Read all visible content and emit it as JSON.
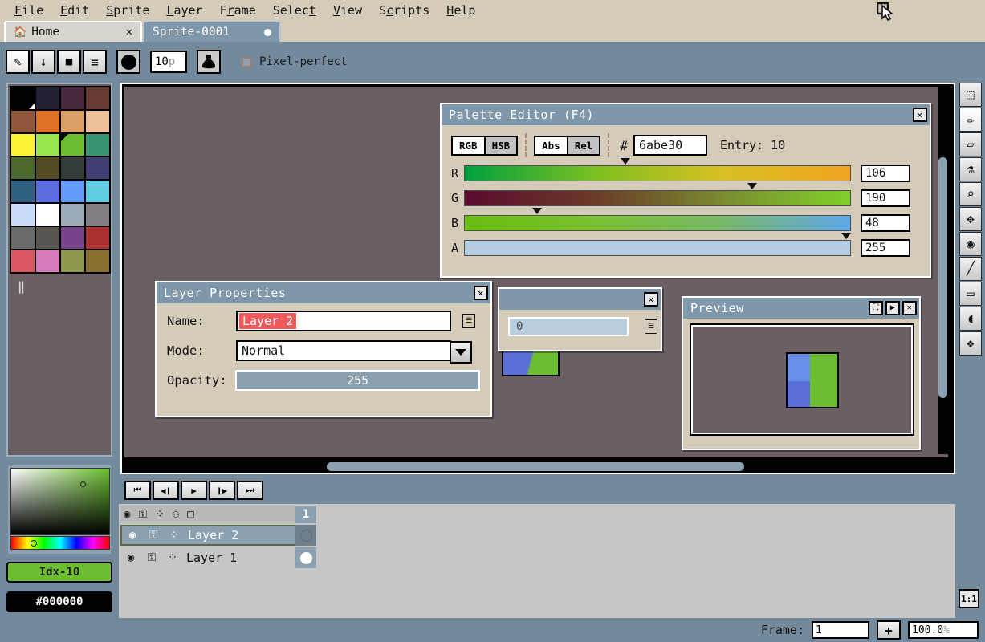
{
  "menu": {
    "items": [
      "File",
      "Edit",
      "Sprite",
      "Layer",
      "Frame",
      "Select",
      "View",
      "Scripts",
      "Help"
    ]
  },
  "tabs": [
    {
      "label": "Home",
      "icon": "home-icon",
      "close": "✕",
      "active": false
    },
    {
      "label": "Sprite-0001",
      "icon": "dot-indicator",
      "active": true
    }
  ],
  "toolbar": {
    "buttons": [
      {
        "name": "pencil-tool-button",
        "glyph": "✎"
      },
      {
        "name": "down-arrow-button",
        "glyph": "↓"
      },
      {
        "name": "square-button",
        "glyph": "■"
      },
      {
        "name": "menu-button",
        "glyph": "≡"
      }
    ],
    "brush_shape": "circle",
    "brush_size": "10",
    "brush_size_unit": "p",
    "ink_button": "ink-bucket-icon",
    "pixel_perfect_label": "Pixel-perfect",
    "pixel_perfect_checked": false
  },
  "palette": {
    "selected_index": 10,
    "colors": [
      "#000000",
      "#222034",
      "#45283c",
      "#663931",
      "#8f563b",
      "#df7126",
      "#d9a066",
      "#eec39a",
      "#fbf236",
      "#99e550",
      "#6abe30",
      "#37946e",
      "#4b692f",
      "#524b24",
      "#323c39",
      "#3f3f74",
      "#306082",
      "#5b6ee1",
      "#639bff",
      "#5fcde4",
      "#cbdbfc",
      "#ffffff",
      "#9badb7",
      "#847e87",
      "#696a6a",
      "#595652",
      "#76428a",
      "#ac3232",
      "#d95763",
      "#d77bba",
      "#8f974a",
      "#8a6f30"
    ],
    "pause_glyph": "‖"
  },
  "color_picker": {
    "fg_label": "Idx-10",
    "fg_color": "#6abe30",
    "bg_label": "#000000",
    "bg_color": "#000000"
  },
  "canvas": {
    "hscroll": "horizontal-scrollbar",
    "vscroll": "vertical-scrollbar"
  },
  "right_tools": [
    {
      "name": "marquee-select-tool",
      "glyph": "⬚"
    },
    {
      "name": "pencil-tool",
      "glyph": "✏"
    },
    {
      "name": "eraser-tool",
      "glyph": "▱"
    },
    {
      "name": "eyedropper-tool",
      "glyph": "⚗"
    },
    {
      "name": "zoom-tool",
      "glyph": "⌕"
    },
    {
      "name": "move-tool",
      "glyph": "✥"
    },
    {
      "name": "paint-bucket-tool",
      "glyph": "◉"
    },
    {
      "name": "line-tool",
      "glyph": "╱"
    },
    {
      "name": "rectangle-tool",
      "glyph": "▭"
    },
    {
      "name": "contour-tool",
      "glyph": "◖"
    },
    {
      "name": "spray-tool",
      "glyph": "❖"
    }
  ],
  "zoom_reset_label": "1:1",
  "timeline": {
    "playback_buttons": [
      {
        "name": "go-to-first-frame-button",
        "glyph": "⏮"
      },
      {
        "name": "previous-frame-button",
        "glyph": "◀❙"
      },
      {
        "name": "play-button",
        "glyph": "▶"
      },
      {
        "name": "next-frame-button",
        "glyph": "❙▶"
      },
      {
        "name": "go-to-last-frame-button",
        "glyph": "⏭"
      }
    ],
    "header_icons": [
      {
        "name": "eye-visibility-icon",
        "glyph": "◉"
      },
      {
        "name": "lock-editable-icon",
        "glyph": "⚿"
      },
      {
        "name": "link-cels-icon",
        "glyph": "⁘"
      },
      {
        "name": "onion-skin-icon",
        "glyph": "⚇"
      },
      {
        "name": "new-frame-icon",
        "glyph": "□"
      }
    ],
    "frame_header": "1",
    "layers": [
      {
        "name": "Layer 2",
        "selected": true,
        "visible": true,
        "locked": false
      },
      {
        "name": "Layer 1",
        "selected": false,
        "visible": true,
        "locked": false
      }
    ]
  },
  "statusbar": {
    "frame_label": "Frame:",
    "frame_value": "1",
    "add_frame_label": "+",
    "zoom_value": "100.0",
    "zoom_unit": "%"
  },
  "dialogs": {
    "palette_editor": {
      "title": "Palette Editor (F4)",
      "close": "✕",
      "color_mode_tabs": [
        {
          "label": "RGB",
          "active": true
        },
        {
          "label": "HSB",
          "active": false
        }
      ],
      "range_tabs": [
        {
          "label": "Abs",
          "active": true
        },
        {
          "label": "Rel",
          "active": false
        }
      ],
      "hash_symbol": "#",
      "hex_value": "6abe30",
      "entry_label": "Entry: 10",
      "channels": [
        {
          "label": "R",
          "value": "106",
          "pos_pct": 41.6,
          "gradient": "linear-gradient(to right,#00a040,#7ac020,#d8c020,#f0a420)"
        },
        {
          "label": "G",
          "value": "190",
          "pos_pct": 74.5,
          "gradient": "linear-gradient(to right,#5b0a2e,#6a3a28,#7a8a30,#7fd02a)"
        },
        {
          "label": "B",
          "value": "48",
          "pos_pct": 18.8,
          "gradient": "linear-gradient(to right,#6abe12,#7ac030,#79b868,#5fa8e8)"
        },
        {
          "label": "A",
          "value": "255",
          "pos_pct": 99.0,
          "gradient": "linear-gradient(to right,#b4cde2,#b4cde2)"
        }
      ]
    },
    "layer_properties": {
      "title": "Layer Properties",
      "close": "✕",
      "name_label": "Name:",
      "name_value": "Layer 2",
      "mode_label": "Mode:",
      "mode_value": "Normal",
      "opacity_label": "Opacity:",
      "opacity_value": "255"
    },
    "behind_dialog": {
      "close": "✕",
      "field_value": "0"
    },
    "preview": {
      "title": "Preview",
      "fullscreen": "⛶",
      "play": "▶",
      "close": "✕"
    }
  }
}
